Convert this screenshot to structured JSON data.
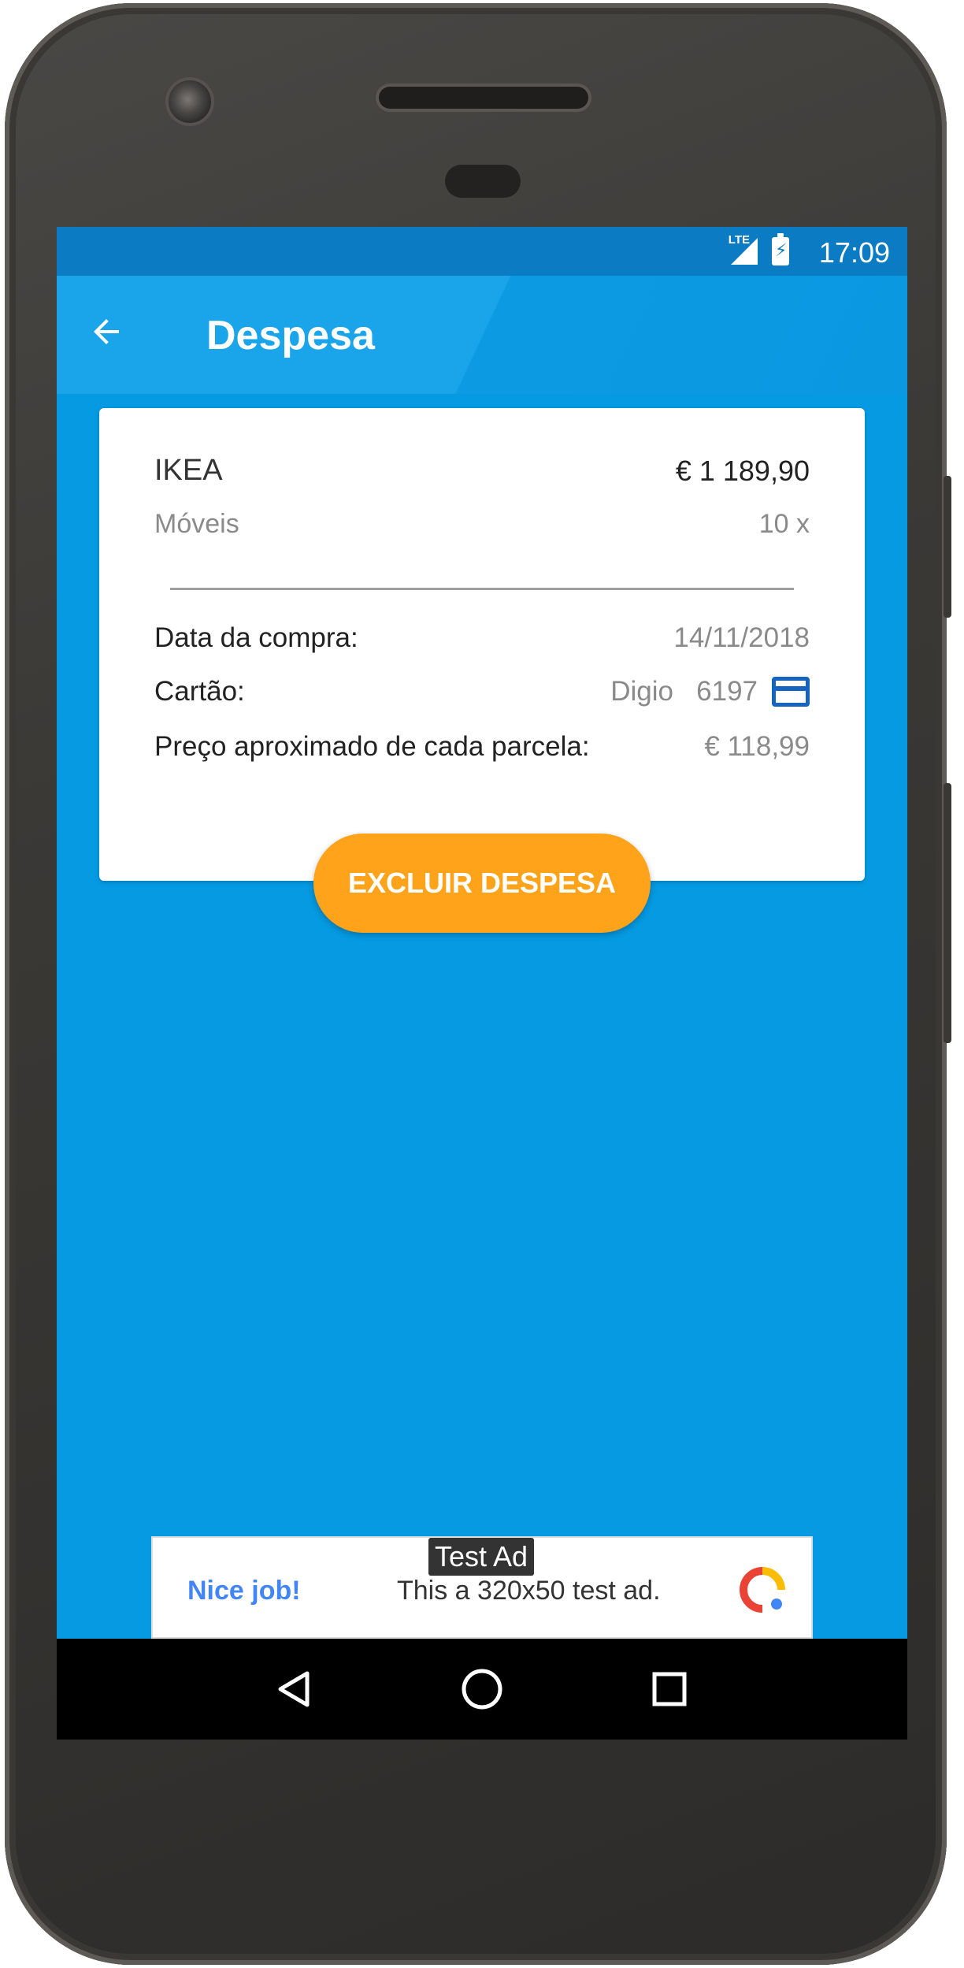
{
  "status_bar": {
    "network": "LTE",
    "time": "17:09"
  },
  "toolbar": {
    "title": "Despesa",
    "back_icon": "arrow-back-icon"
  },
  "expense": {
    "store": "IKEA",
    "total": "€ 1 189,90",
    "category": "Móveis",
    "installments": "10 x",
    "details": [
      {
        "label": "Data da compra:",
        "value": "14/11/2018"
      },
      {
        "label": "Cartão:",
        "value": "Digio   6197"
      },
      {
        "label": "Preço aproximado de cada parcela:",
        "value": "€ 118,99"
      }
    ]
  },
  "actions": {
    "delete_label": "EXCLUIR DESPESA"
  },
  "ad": {
    "badge": "Test Ad",
    "headline": "Nice job!",
    "body": "This a 320x50 test ad."
  },
  "colors": {
    "primary": "#059ae2",
    "status_bar": "#0b7bc4",
    "accent": "#ffa41a",
    "card_icon": "#1565c0"
  }
}
